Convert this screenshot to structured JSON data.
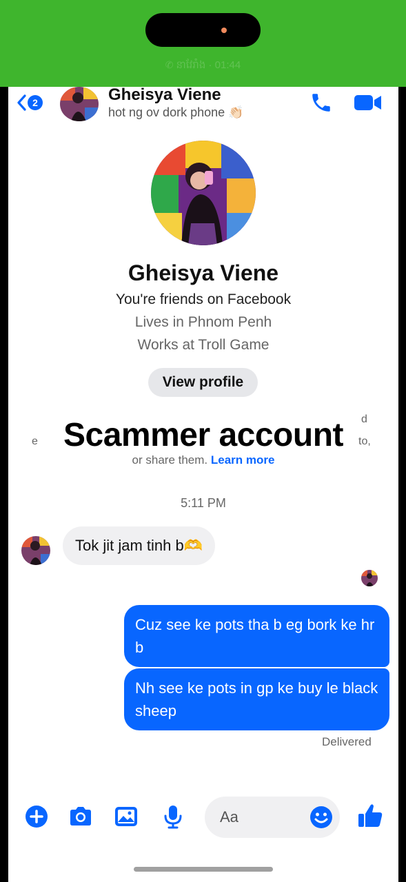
{
  "call_banner": {
    "status_text": "នាវែរាំង · 01:44"
  },
  "header": {
    "unread_count": "2",
    "contact_name": "Gheisya Viene",
    "subtitle": "hot ng ov dork phone",
    "subtitle_emoji": "👏🏻"
  },
  "profile": {
    "name": "Gheisya Viene",
    "friends_line": "You're friends on Facebook",
    "lives_line": "Lives in Phnom Penh",
    "works_line": "Works at Troll Game",
    "view_profile_label": "View profile"
  },
  "notice": {
    "fragment_left": "e",
    "fragment_right_top": "d",
    "fragment_right": "to,",
    "line_prefix": "or share them.",
    "learn_more": "Learn more"
  },
  "overlay_text": "Scammer account",
  "conversation": {
    "timestamp": "5:11 PM",
    "incoming": [
      {
        "text": "Tok jit jam tinh b🫶"
      }
    ],
    "outgoing": [
      {
        "text": "Cuz see ke pots tha b eg bork ke hr b"
      },
      {
        "text": "Nh see ke pots in gp ke buy le black sheep"
      }
    ],
    "status": "Delivered"
  },
  "composer": {
    "placeholder": "Aa",
    "icons": [
      "plus-icon",
      "camera-icon",
      "gallery-icon",
      "microphone-icon",
      "emoji-icon",
      "thumbs-up-icon"
    ]
  },
  "colors": {
    "messenger_blue": "#0866ff",
    "call_banner_green": "#3fb52d",
    "bubble_gray": "#f0f0f2"
  }
}
